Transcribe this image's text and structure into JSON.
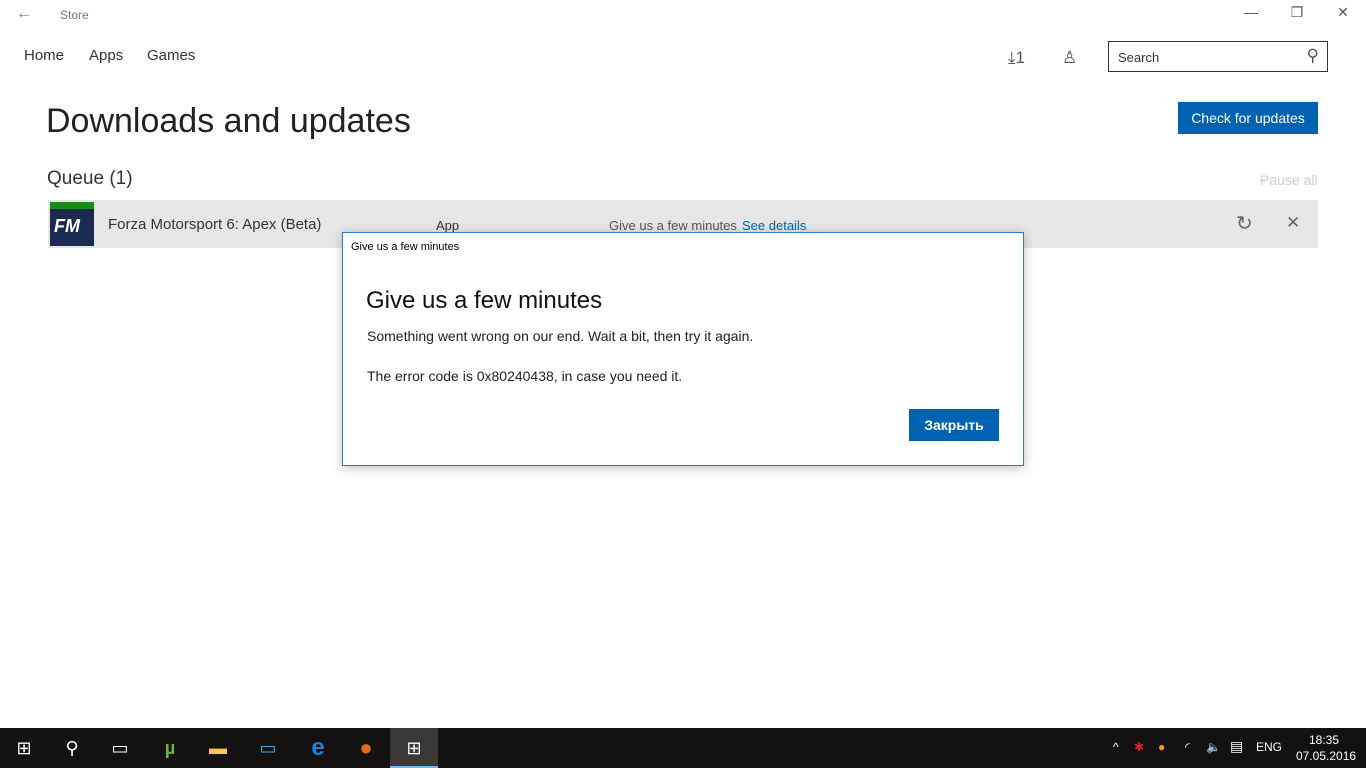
{
  "window": {
    "title": "Store",
    "back": "←",
    "min": "—",
    "restore": "❐",
    "close": "✕"
  },
  "nav": {
    "home": "Home",
    "apps": "Apps",
    "games": "Games"
  },
  "header": {
    "downloads_icon": "⤓",
    "downloads_count": "1",
    "account_icon": "♙",
    "search_placeholder": "Search",
    "search_icon": "⚲"
  },
  "page": {
    "title": "Downloads and updates",
    "check_updates": "Check for updates",
    "queue": "Queue (1)",
    "pause_all": "Pause all"
  },
  "queue_item": {
    "thumb_text": "FM",
    "name": "Forza Motorsport 6: Apex (Beta)",
    "type": "App",
    "status": "Give us a few minutes",
    "details_link": "See details",
    "retry_icon": "↻",
    "cancel_icon": "✕"
  },
  "dialog": {
    "title": "Give us a few minutes",
    "heading": "Give us a few minutes",
    "message": "Something went wrong on our end. Wait a bit, then try it again.",
    "error": "The error code is 0x80240438, in case you need it.",
    "close": "Закрыть"
  },
  "taskbar": {
    "start": "⊞",
    "search": "⚲",
    "taskview": "▭",
    "utorrent": "µ",
    "explorer": "▬",
    "pc": "▭",
    "edge": "e",
    "firefox": "●",
    "store": "⊞"
  },
  "tray": {
    "chevron": "^",
    "lang": "ENG",
    "time": "18:35",
    "date": "07.05.2016",
    "volume": "🔈",
    "notif": "▤"
  }
}
